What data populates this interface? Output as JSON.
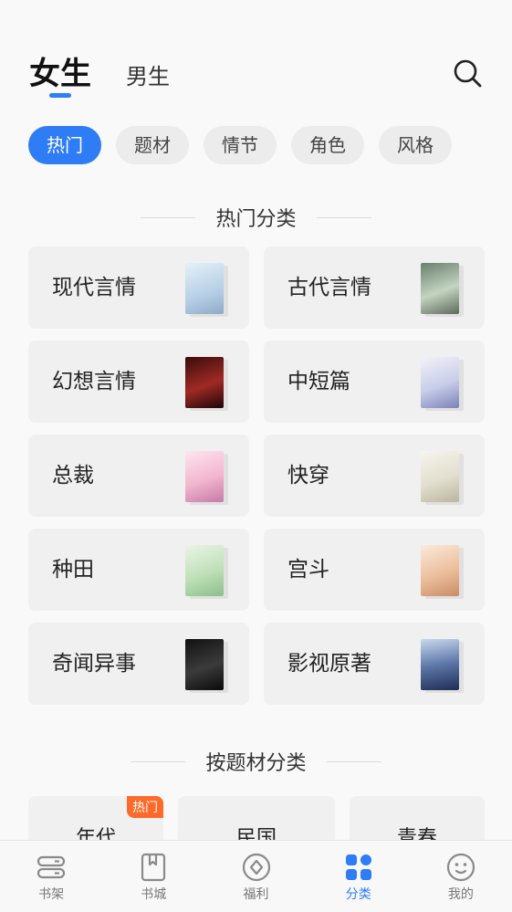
{
  "header": {
    "tab_female": "女生",
    "tab_male": "男生",
    "search_icon": "search-icon"
  },
  "filters": [
    "热门",
    "题材",
    "情节",
    "角色",
    "风格"
  ],
  "hot_section": {
    "title": "热门分类",
    "items": [
      {
        "label": "现代言情",
        "cover_color": "#cfe2f0"
      },
      {
        "label": "古代言情",
        "cover_color": "#9cb4a0"
      },
      {
        "label": "幻想言情",
        "cover_color": "#7a1f1f"
      },
      {
        "label": "中短篇",
        "cover_color": "#d9dcef"
      },
      {
        "label": "总裁",
        "cover_color": "#f5c8dc"
      },
      {
        "label": "快穿",
        "cover_color": "#ecebe2"
      },
      {
        "label": "种田",
        "cover_color": "#cde6c9"
      },
      {
        "label": "宫斗",
        "cover_color": "#f2d2b6"
      },
      {
        "label": "奇闻异事",
        "cover_color": "#222222"
      },
      {
        "label": "影视原著",
        "cover_color": "#3a4c78"
      }
    ]
  },
  "theme_section": {
    "title": "按题材分类",
    "items": [
      {
        "label": "年代",
        "badge": "热门"
      },
      {
        "label": "民国",
        "badge": ""
      },
      {
        "label": "青春",
        "badge": ""
      }
    ]
  },
  "bottom_nav": [
    {
      "label": "书架",
      "icon": "bookshelf-icon"
    },
    {
      "label": "书城",
      "icon": "bookstore-icon"
    },
    {
      "label": "福利",
      "icon": "welfare-icon"
    },
    {
      "label": "分类",
      "icon": "category-icon"
    },
    {
      "label": "我的",
      "icon": "profile-icon"
    }
  ],
  "colors": {
    "accent": "#2e7cf6",
    "hot_badge": "#ff6a2a"
  }
}
